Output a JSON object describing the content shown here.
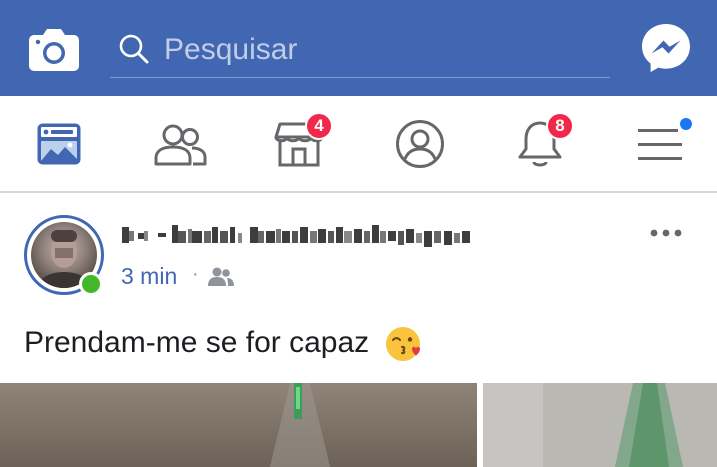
{
  "header": {
    "search_placeholder": "Pesquisar",
    "icons": {
      "camera": "camera-icon",
      "search": "search-icon",
      "messenger": "messenger-icon"
    }
  },
  "nav": {
    "items": [
      {
        "name": "news-feed",
        "icon": "news-feed-icon",
        "active": true
      },
      {
        "name": "friends",
        "icon": "friends-icon"
      },
      {
        "name": "marketplace",
        "icon": "marketplace-icon",
        "badge": "4"
      },
      {
        "name": "profile",
        "icon": "profile-icon"
      },
      {
        "name": "notifications",
        "icon": "bell-icon",
        "badge": "8"
      },
      {
        "name": "menu",
        "icon": "menu-icon",
        "has_dot": true
      }
    ]
  },
  "post": {
    "timestamp": "3 min",
    "separator": "·",
    "audience_icon": "friends-audience-icon",
    "text": "Prendam-me se for capaz",
    "emoji": "kissing-face-emoji"
  },
  "colors": {
    "brand_blue": "#4267b2",
    "badge_red": "#f0284a",
    "online_green": "#42b72a",
    "notification_dot": "#1877f2"
  }
}
